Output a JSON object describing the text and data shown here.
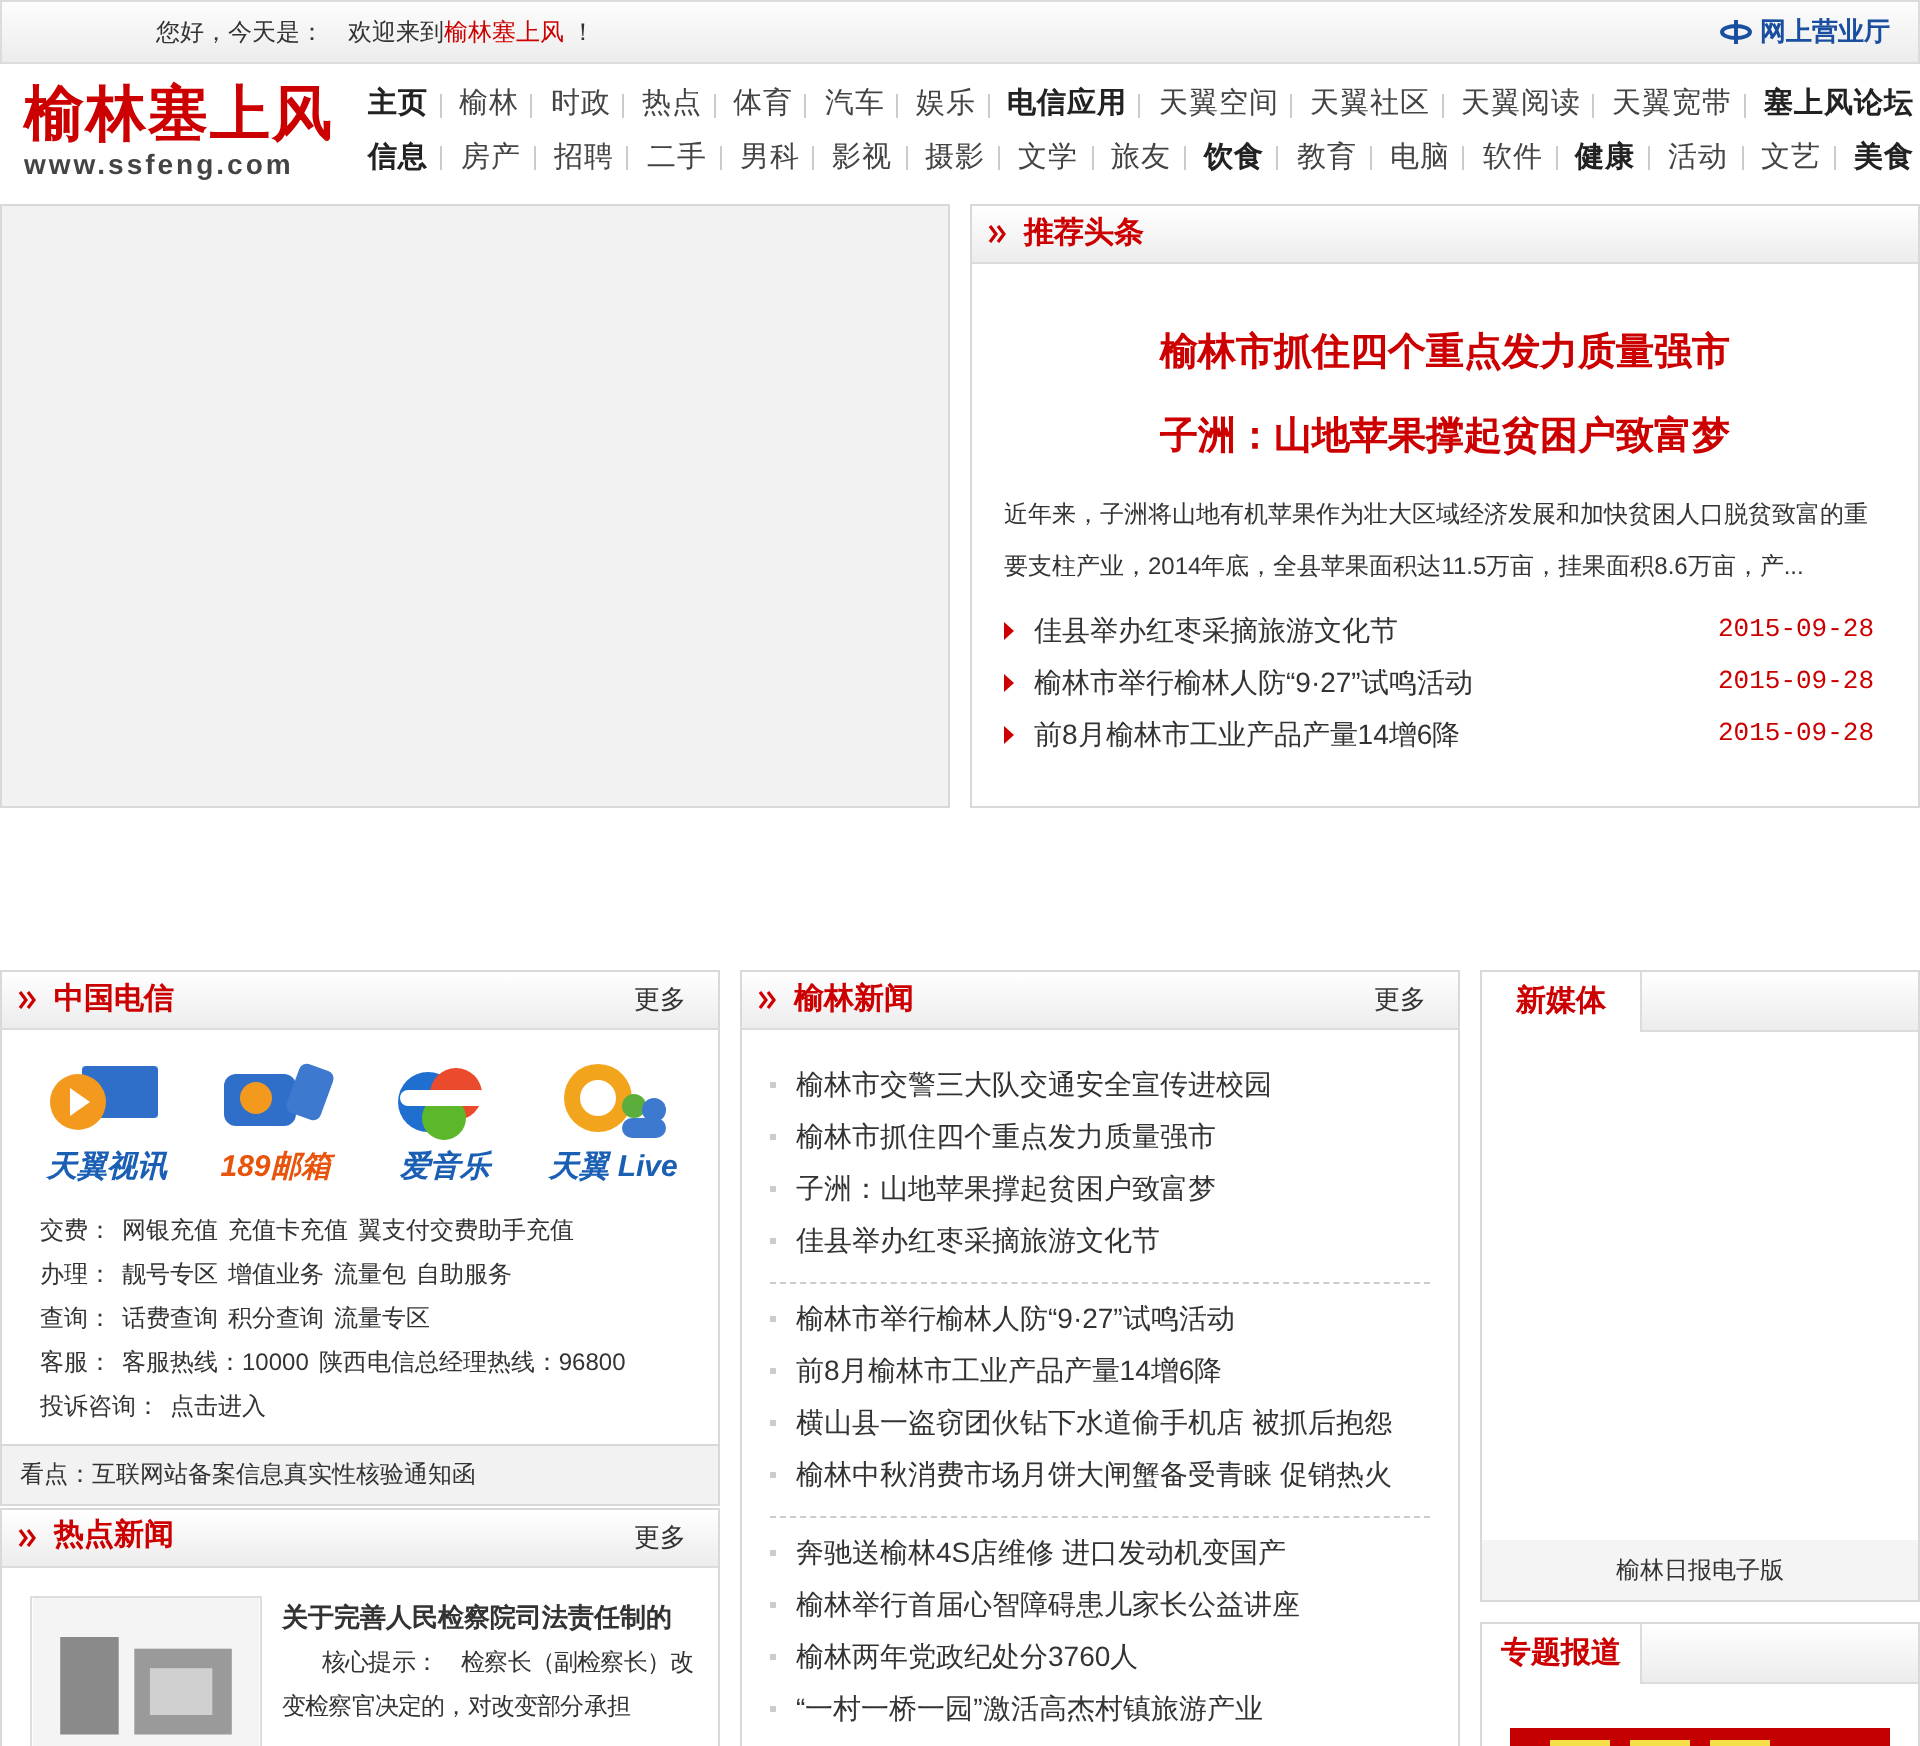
{
  "topbar": {
    "greeting": "您好，今天是：",
    "welcome_prefix": "欢迎来到",
    "site_name": "榆林塞上风",
    "welcome_suffix": "！",
    "service_link": "网上营业厅"
  },
  "logo": {
    "title": "榆林塞上风",
    "url": "www.ssfeng.com"
  },
  "nav_rows": [
    [
      {
        "label": "主页",
        "bold": true
      },
      {
        "label": "榆林",
        "bold": false
      },
      {
        "label": "时政",
        "bold": false
      },
      {
        "label": "热点",
        "bold": false
      },
      {
        "label": "体育",
        "bold": false
      },
      {
        "label": "汽车",
        "bold": false
      },
      {
        "label": "娱乐",
        "bold": false
      },
      {
        "label": "电信应用",
        "bold": true
      },
      {
        "label": "天翼空间",
        "bold": false
      },
      {
        "label": "天翼社区",
        "bold": false
      },
      {
        "label": "天翼阅读",
        "bold": false
      },
      {
        "label": "天翼宽带",
        "bold": false
      },
      {
        "label": "塞上风论坛",
        "bold": true
      }
    ],
    [
      {
        "label": "信息",
        "bold": true
      },
      {
        "label": "房产",
        "bold": false
      },
      {
        "label": "招聘",
        "bold": false
      },
      {
        "label": "二手",
        "bold": false
      },
      {
        "label": "男科",
        "bold": false
      },
      {
        "label": "影视",
        "bold": false
      },
      {
        "label": "摄影",
        "bold": false
      },
      {
        "label": "文学",
        "bold": false
      },
      {
        "label": "旅友",
        "bold": false
      },
      {
        "label": "饮食",
        "bold": true
      },
      {
        "label": "教育",
        "bold": false
      },
      {
        "label": "电脑",
        "bold": false
      },
      {
        "label": "软件",
        "bold": false
      },
      {
        "label": "健康",
        "bold": true
      },
      {
        "label": "活动",
        "bold": false
      },
      {
        "label": "文艺",
        "bold": false
      },
      {
        "label": "美食",
        "bold": true
      }
    ]
  ],
  "headline": {
    "title": "推荐头条",
    "lead_titles": [
      "榆林市抓住四个重点发力质量强市",
      "子洲：山地苹果撑起贫困户致富梦"
    ],
    "summary": "近年来，子洲将山地有机苹果作为壮大区域经济发展和加快贫困人口脱贫致富的重要支柱产业，2014年底，全县苹果面积达11.5万亩，挂果面积8.6万亩，产...",
    "items": [
      {
        "title": "佳县举办红枣采摘旅游文化节",
        "date": "2015-09-28"
      },
      {
        "title": "榆林市举行榆林人防“9·27”试鸣活动",
        "date": "2015-09-28"
      },
      {
        "title": "前8月榆林市工业产品产量14增6降",
        "date": "2015-09-28"
      }
    ]
  },
  "telecom": {
    "title": "中国电信",
    "more": "更多",
    "apps": [
      {
        "label": "天翼视讯",
        "color": "#1a5fb4"
      },
      {
        "label": "189邮箱",
        "color": "#e8540c"
      },
      {
        "label": "爱音乐",
        "color": "#1a5fb4"
      },
      {
        "label": "天翼 Live",
        "color": "#1a5fb4"
      }
    ],
    "rows": [
      {
        "label": "交费：",
        "links": [
          "网银充值",
          "充值卡充值",
          "翼支付交费助手充值"
        ]
      },
      {
        "label": "办理：",
        "links": [
          "靓号专区",
          "增值业务",
          "流量包",
          "自助服务"
        ]
      },
      {
        "label": "查询：",
        "links": [
          "话费查询",
          "积分查询",
          "流量专区"
        ]
      },
      {
        "label": "客服：",
        "links": [
          "客服热线：10000",
          "陕西电信总经理热线：96800"
        ]
      },
      {
        "label": "投诉咨询：",
        "links": [
          "点击进入"
        ]
      }
    ],
    "notice": "看点：互联网站备案信息真实性核验通知函"
  },
  "hot_news": {
    "title": "热点新闻",
    "more": "更多",
    "item_title": "关于完善人民检察院司法责任制的",
    "item_summary": "核心提示：　检察长（副检察长）改变检察官决定的，对改变部分承担"
  },
  "local_news": {
    "title": "榆林新闻",
    "more": "更多",
    "groups": [
      [
        "榆林市交警三大队交通安全宣传进校园",
        "榆林市抓住四个重点发力质量强市",
        "子洲：山地苹果撑起贫困户致富梦",
        "佳县举办红枣采摘旅游文化节"
      ],
      [
        "榆林市举行榆林人防“9·27”试鸣活动",
        "前8月榆林市工业产品产量14增6降",
        "横山县一盗窃团伙钻下水道偷手机店 被抓后抱怨",
        "榆林中秋消费市场月饼大闸蟹备受青睐 促销热火"
      ],
      [
        "奔驰送榆林4S店维修 进口发动机变国产",
        "榆林举行首届心智障碍患儿家长公益讲座",
        "榆林两年党政纪处分3760人",
        "“一村一桥一园”激活高杰村镇旅游产业"
      ]
    ]
  },
  "new_media": {
    "title": "新媒体",
    "caption": "榆林日报电子版"
  },
  "special": {
    "title": "专题报道"
  }
}
